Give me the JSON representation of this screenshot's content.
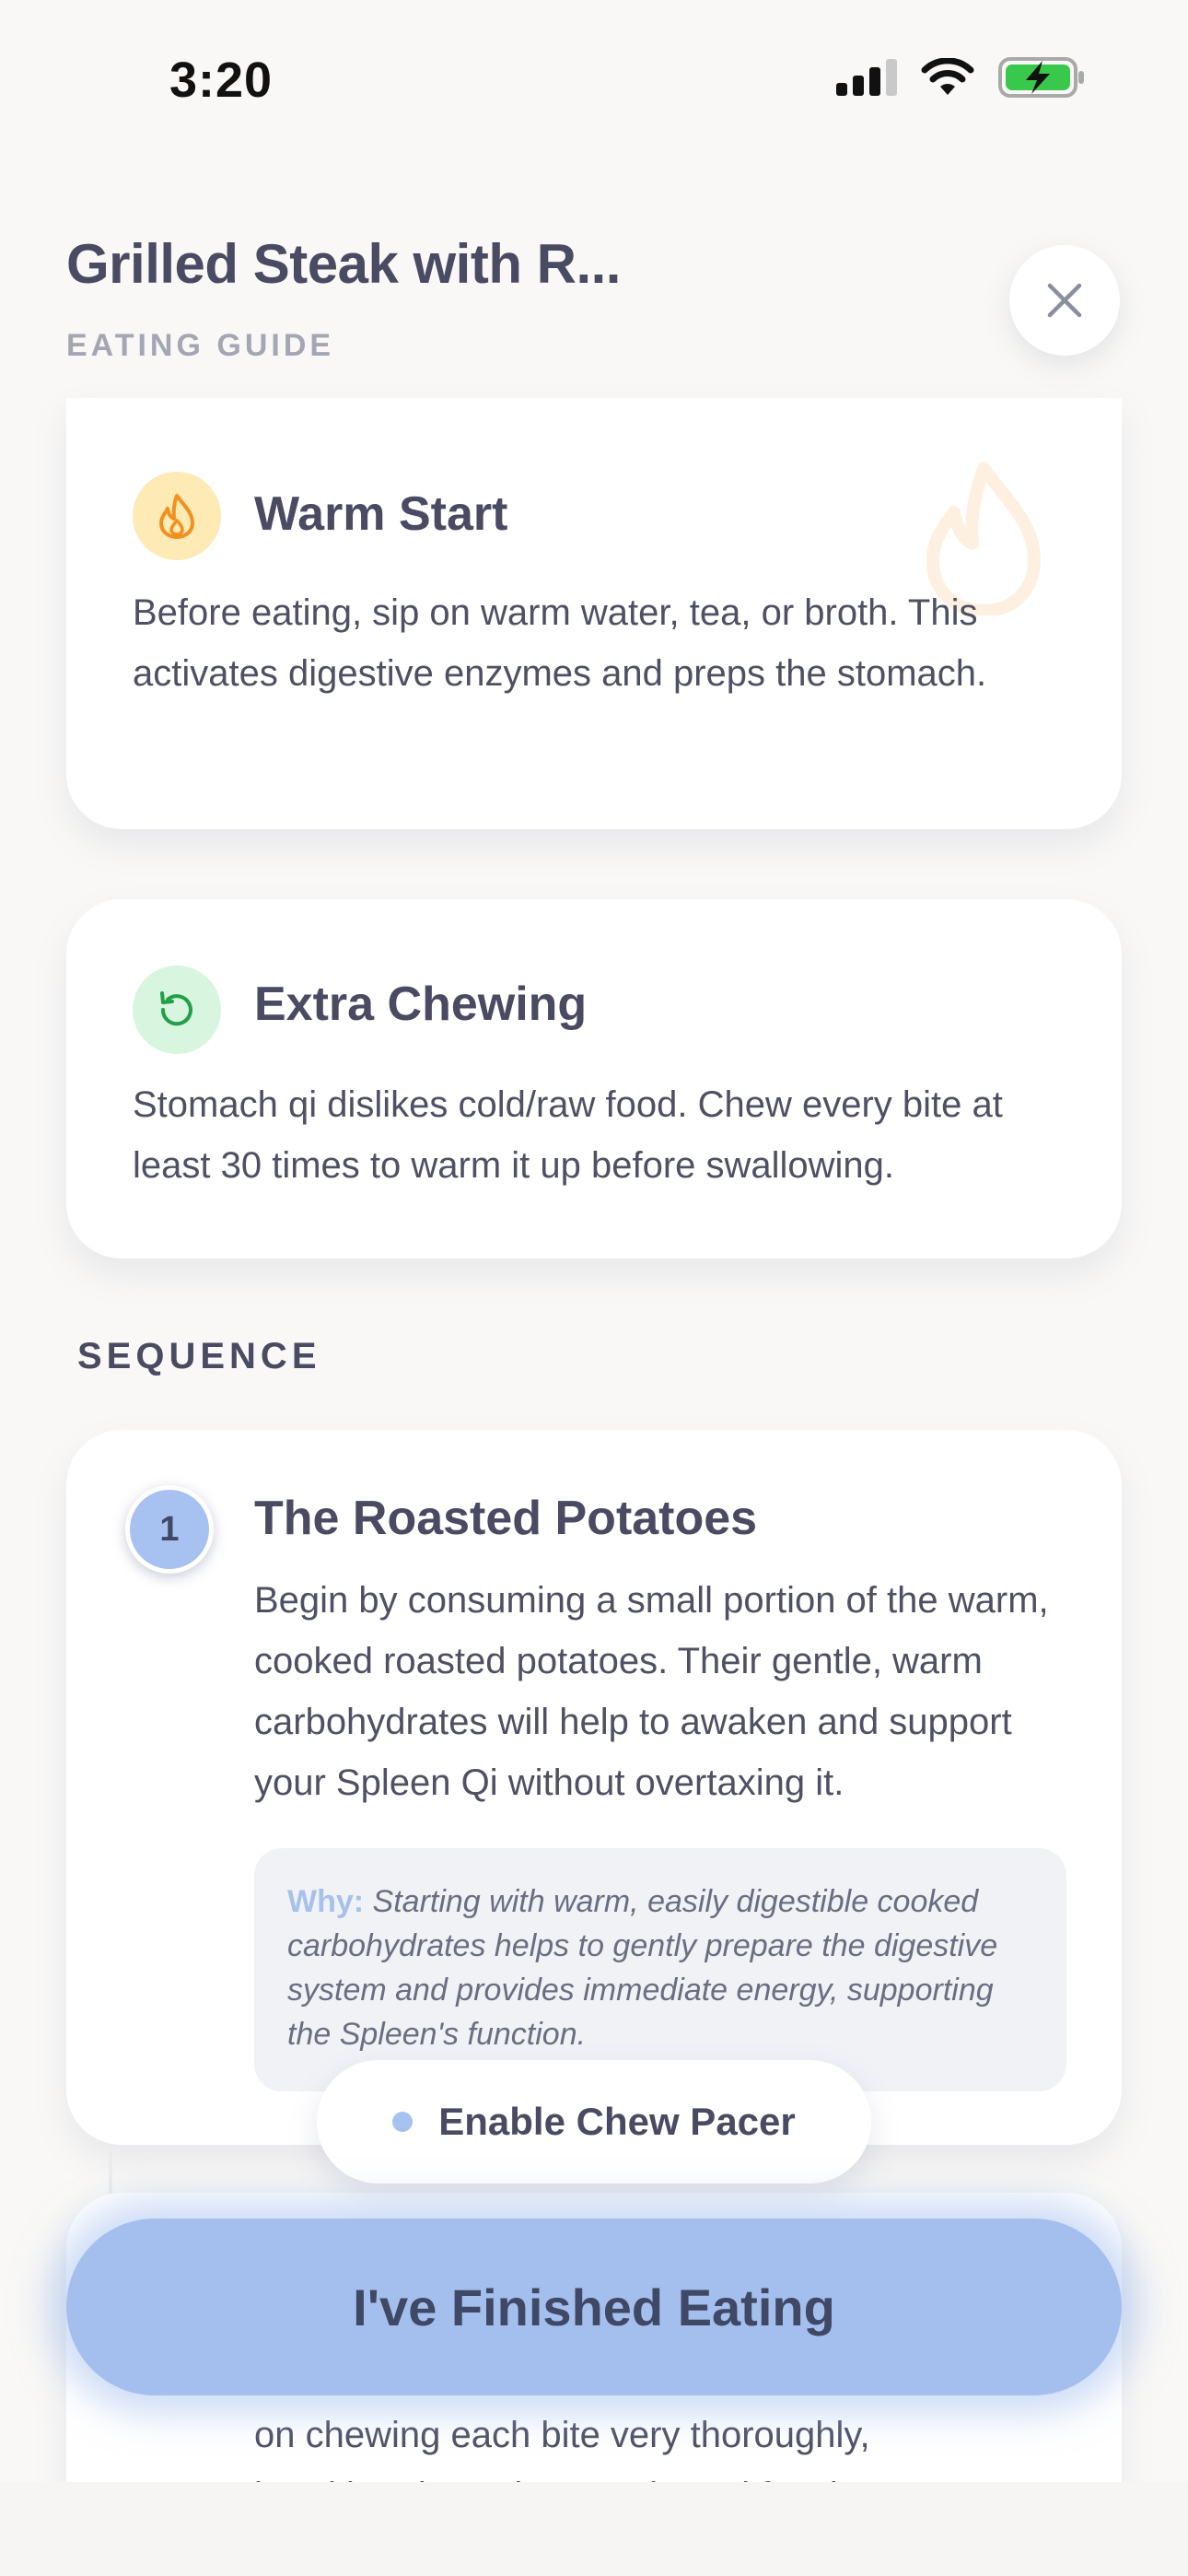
{
  "status_bar": {
    "time": "3:20"
  },
  "header": {
    "title": "Grilled Steak with R...",
    "subtitle": "EATING GUIDE"
  },
  "tips": [
    {
      "title": "Warm Start",
      "body": "Before eating, sip on warm water, tea, or broth. This activates digestive enzymes and preps the stomach.",
      "icon": "flame-icon"
    },
    {
      "title": "Extra Chewing",
      "body": "Stomach qi dislikes cold/raw food. Chew every bite at least 30 times to warm it up before swallowing.",
      "icon": "refresh-icon"
    }
  ],
  "sequence": {
    "label": "SEQUENCE",
    "steps": [
      {
        "number": "1",
        "title": "The Roasted Potatoes",
        "body": "Begin by consuming a small portion of the warm, cooked roasted potatoes. Their gentle, warm carbohydrates will help to awaken and support your Spleen Qi without overtaxing it.",
        "why_label": "Why:",
        "why_text": "Starting with warm, easily digestible cooked carbohydrates helps to gently prepare the digestive system and provides immediate energy, supporting the Spleen's function."
      }
    ],
    "next_step_partial": [
      "on chewing each bite very thoroughly,",
      "breaking down the protein and fats into"
    ]
  },
  "actions": {
    "chew_pacer": "Enable Chew Pacer",
    "finish": "I've Finished Eating"
  },
  "colors": {
    "accent": "#a7c2f0",
    "text": "#4a4b63",
    "flame": "#f2901d",
    "green": "#22a048"
  }
}
